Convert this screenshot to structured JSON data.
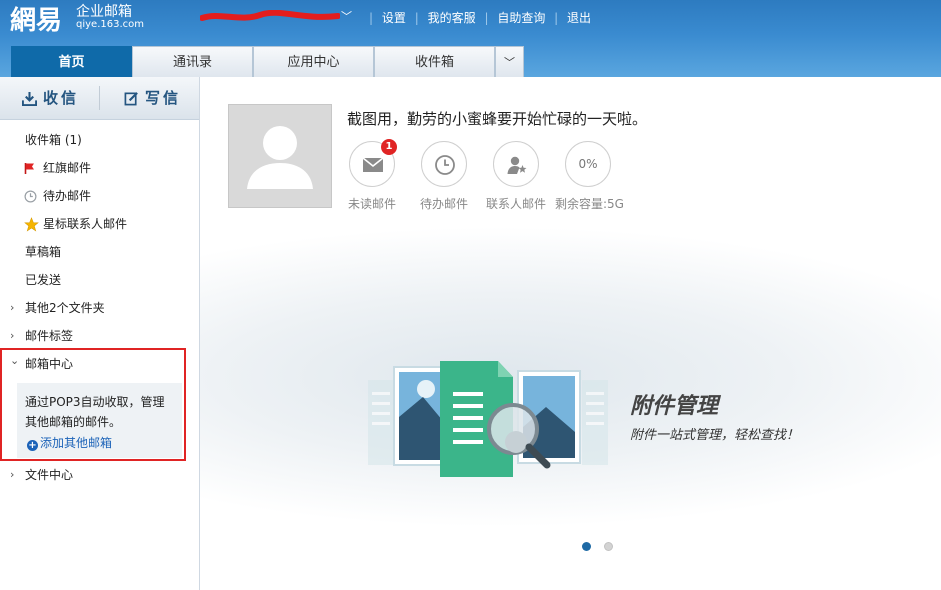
{
  "header": {
    "logo_big": "網易",
    "logo_sub1": "企业邮箱",
    "logo_sub2": "qiye.163.com",
    "account_arrow": "﹀",
    "links": [
      "设置",
      "我的客服",
      "自助查询",
      "退出"
    ]
  },
  "tabs": [
    {
      "label": "首页",
      "active": true
    },
    {
      "label": "通讯录"
    },
    {
      "label": "应用中心"
    },
    {
      "label": "收件箱"
    }
  ],
  "tab_more": "﹀",
  "sidebar": {
    "receive_label": "收信",
    "compose_label": "写信",
    "items": [
      {
        "label": "收件箱 (1)"
      },
      {
        "label": "红旗邮件",
        "icon": "red-flag-icon"
      },
      {
        "label": "待办邮件",
        "icon": "clock-icon"
      },
      {
        "label": "星标联系人邮件",
        "icon": "star-icon"
      },
      {
        "label": "草稿箱"
      },
      {
        "label": "已发送"
      },
      {
        "label": "其他2个文件夹",
        "chevron": "›"
      },
      {
        "label": "邮件标签",
        "chevron": "›"
      },
      {
        "label": "邮箱中心",
        "chevron": "⌄"
      },
      {
        "label": "文件中心",
        "chevron": "›"
      }
    ],
    "mailbox_center": {
      "info": "通过POP3自动收取，管理其他邮箱的邮件。",
      "add_label": "添加其他邮箱",
      "plus": "+"
    }
  },
  "main": {
    "greeting": "截图用，勤劳的小蜜蜂要开始忙碌的一天啦。",
    "stats": [
      {
        "label": "未读邮件",
        "icon": "envelope-icon",
        "badge": "1"
      },
      {
        "label": "待办邮件",
        "icon": "clock-icon"
      },
      {
        "label": "联系人邮件",
        "icon": "contact-star-icon"
      },
      {
        "label": "剩余容量:5G",
        "value": "0%"
      }
    ],
    "promo": {
      "title": "附件管理",
      "subtitle": "附件一站式管理，轻松查找！"
    },
    "carousel": {
      "count": 2,
      "active_index": 0
    }
  },
  "colors": {
    "header_blue": "#3a8bd0",
    "active_tab": "#0f6aa9",
    "highlight_red": "#e02424",
    "link_blue": "#1c63b8",
    "promo_green": "#3bb58a"
  }
}
